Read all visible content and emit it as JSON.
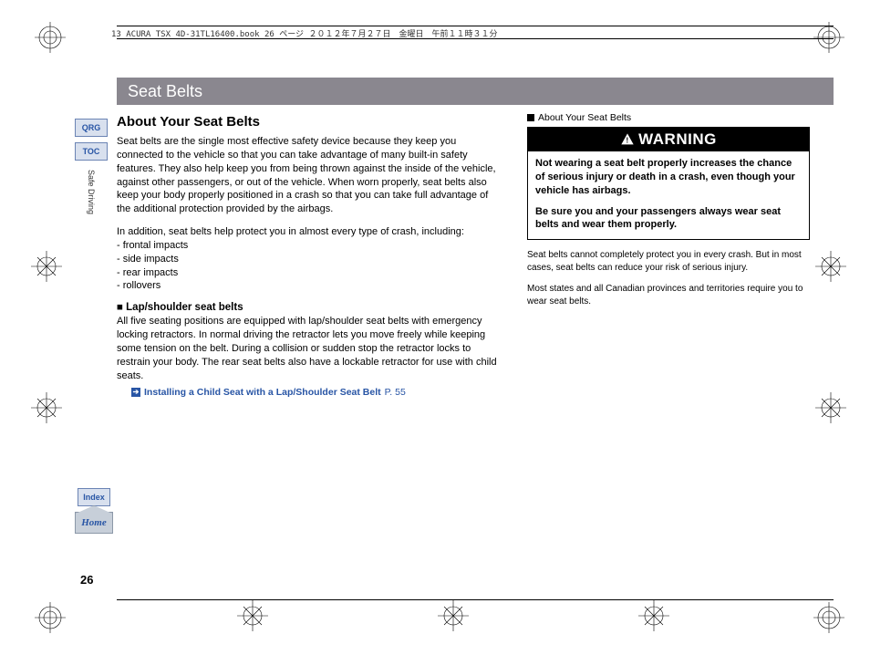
{
  "meta_line": "13 ACURA TSX 4D-31TL16400.book  26 ページ  ２０１２年７月２７日　金曜日　午前１１時３１分",
  "header_title": "Seat Belts",
  "section_title": "About Your Seat Belts",
  "para1": "Seat belts are the single most effective safety device because they keep you connected to the vehicle so that you can take advantage of many built-in safety features. They also help keep you from being thrown against the inside of the vehicle, against other passengers, or out of the vehicle. When worn properly, seat belts also keep your body properly positioned in a crash so that you can take full advantage of the additional protection provided by the airbags.",
  "para2_intro": "In addition, seat belts help protect you in almost every type of crash, including:",
  "impacts": [
    "- frontal impacts",
    "- side impacts",
    "- rear impacts",
    "- rollovers"
  ],
  "subhead": "Lap/shoulder seat belts",
  "para3": "All five seating positions are equipped with lap/shoulder seat belts with emergency locking retractors. In normal driving the retractor lets you move freely while keeping some tension on the belt. During a collision or sudden stop the retractor locks to restrain your body. The rear seat belts also have a lockable retractor for use with child seats.",
  "xref": {
    "label": "Installing a Child Seat with a Lap/Shoulder Seat Belt",
    "page": "P. 55"
  },
  "about_marker": "About Your Seat Belts",
  "warning_title": "WARNING",
  "warning_p1": "Not wearing a seat belt properly increases the chance of serious injury or death in a crash, even though your vehicle has airbags.",
  "warning_p2": "Be sure you and your passengers always wear seat belts and wear them properly.",
  "side_note1": "Seat belts cannot completely protect you in every crash. But in most cases, seat belts can reduce your risk of serious injury.",
  "side_note2": "Most states and all Canadian provinces and territories require you to wear seat belts.",
  "sidebar": {
    "qrg": "QRG",
    "toc": "TOC",
    "safe": "Safe Driving",
    "index": "Index",
    "home": "Home"
  },
  "page_number": "26"
}
